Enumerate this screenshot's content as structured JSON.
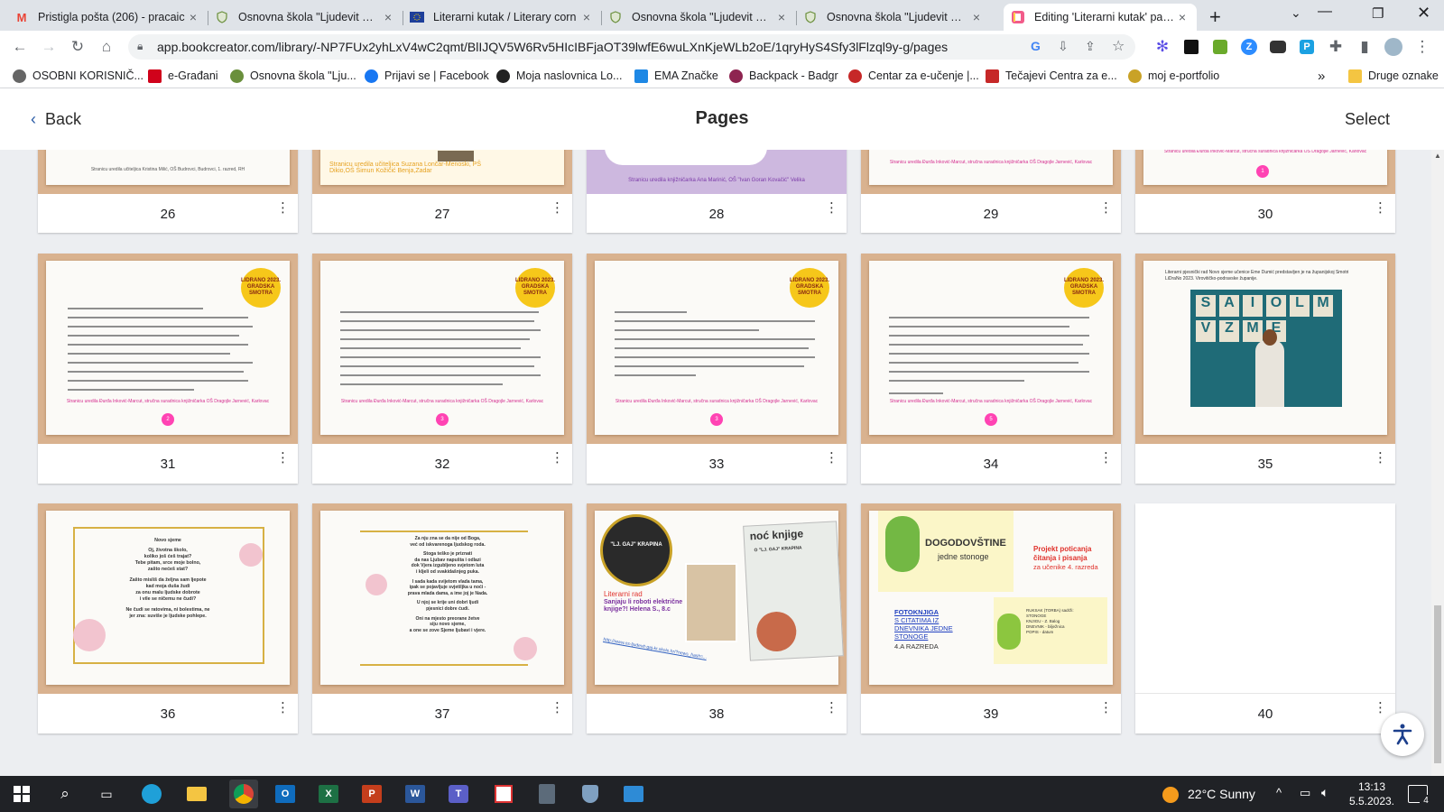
{
  "browser": {
    "tabs": [
      {
        "title": "Pristigla pošta (206) - pracaic",
        "icon": "gmail-icon"
      },
      {
        "title": "Osnovna škola \"Ljudevit Gaj\"",
        "icon": "school-shield-icon"
      },
      {
        "title": "Literarni kutak / Literary corn",
        "icon": "eu-flag-icon"
      },
      {
        "title": "Osnovna škola \"Ljudevit Gaj\"",
        "icon": "school-shield-icon"
      },
      {
        "title": "Osnovna škola \"Ljudevit Gaj\"",
        "icon": "school-shield-icon"
      },
      {
        "title": "Editing 'Literarni kutak' pages",
        "icon": "book-creator-icon"
      }
    ],
    "url": "app.bookcreator.com/library/-NP7FUx2yhLxV4wC2qmt/BlIJQV5W6Rv5HIcIBFjaOT39lwfE6wuLXnKjeWLb2oE/1qryHyS4Sfy3lFlzql9y-g/pages",
    "bookmarks": [
      {
        "label": "OSOBNI KORISNIČ...",
        "color": "#666666"
      },
      {
        "label": "e-Građani",
        "color": "#d0021b"
      },
      {
        "label": "Osnovna škola \"Lju...",
        "color": "#6a8f3c"
      },
      {
        "label": "Prijavi se | Facebook",
        "color": "#1877f2"
      },
      {
        "label": "Moja naslovnica Lo...",
        "color": "#222222"
      },
      {
        "label": "EMA Značke",
        "color": "#1e88e5"
      },
      {
        "label": "Backpack - Badgr",
        "color": "#8e2450"
      },
      {
        "label": "Centar za e-učenje |...",
        "color": "#c62828"
      },
      {
        "label": "Tečajevi Centra za e...",
        "color": "#c62828"
      },
      {
        "label": "moj e-portfolio",
        "color": "#c9a227"
      }
    ],
    "other_bookmarks": "Druge oznake",
    "more_bookmarks": "»"
  },
  "app": {
    "back_label": "Back",
    "title": "Pages",
    "select_label": "Select"
  },
  "pages": {
    "row_top": [
      "26",
      "27",
      "28",
      "29",
      "30"
    ],
    "row_mid": [
      "31",
      "32",
      "33",
      "34",
      "35"
    ],
    "row_bottom": [
      "36",
      "37",
      "38",
      "39",
      "40"
    ],
    "badge_text": "LIDRANO 2023. GRADSKA SMOTRA",
    "credit_30": "Stranicu uredila Đurđa Inković-Marcut, stručna suradnica knjižničarka OŠ Dragojle Jarnević, Karlovac",
    "credit_26": "Stranicu uredila učiteljica Kristina Milić, OŠ Budrovci, Budrovci, 1. razred, RH",
    "credit_27": "Stranicu uredila učiteljica Suzana Lončar-Menoski, PŠ Dikio,OŠ Šimun Kožičić Benja,Zadar",
    "credit_28": "Stranicu uredila knjižničarka Ana Marinić, OŠ \"Ivan Goran Kovačić\" Velika",
    "poem36": {
      "title": "Novo sjeme",
      "lines": [
        "Oj, životna školo,",
        "koliko još ćeš trajat?",
        "Tebe pitam, srce moje bolno,",
        "zašto nećeš stat?",
        "",
        "Zašto misliš da željna sam ljepote",
        "kad moja duša žudi",
        "za onu malu ljudske dobrote",
        "i vile se ničemu ne čudi?",
        "",
        "Ne čudi se ratovima, ni bolestima, ne",
        "jer zna: suviše je ljudske pohlepe."
      ]
    },
    "poem37": {
      "lines": [
        "Za nju zna se da nije od Boga,",
        "već od iskvarenoga ljudskog roda.",
        "",
        "Stoga teško je priznati",
        "da nas Ljubav napušta i odlazi",
        "dok Vjera izgubljeno svjetom luta",
        "i kljeli od svakidašnjeg puka.",
        "",
        "I sada kada svijetom vlada tama,",
        "ipak se pojavljuje svjetiljka u noći -",
        "prava mlada dama, a ime joj je Nada.",
        "",
        "U njoj se krije uni dobri ljudi",
        "pjesnici dobre ćudi.",
        "",
        "Oni na mjesto preorane žetve",
        "siju novo sjeme,",
        "a one se zove Sjeme ljubavi i vjere."
      ]
    },
    "page38": {
      "badge_line1": "\"LJ. GAJ\" KRAPINA",
      "headline": "Literarni rad",
      "subtitle": "Sanjaju li roboti električne knjige?! Helena S., 8.c",
      "link": "http://www.os-ljudevit-gaj-kr.skole.hr/?news_hash=...",
      "poster_title": "noć knjige",
      "poster_sub": "O \"LJ. GAJ\" KRAPINA"
    },
    "page39": {
      "title": "DOGODOVŠTINE",
      "subtitle": "jedne stonoge",
      "project_title": "Projekt poticanja čitanja i pisanja",
      "project_sub": "za učenike 4. razreda",
      "fotoknjiga": "FOTOKNJIGA",
      "fotoknjiga_lines": [
        "S CITATIMA IZ",
        "DNEVNIKA JEDNE",
        "STONOGE",
        "4.A RAZREDA"
      ],
      "ruksak_title": "RUKSAK (TORBA) sadrži:",
      "ruksak_items": [
        "STONOGE",
        "KNJIGU - Z. Balog",
        "DNEVNIK - bilježnica",
        "POPIS - datum"
      ]
    },
    "page35": {
      "letters": [
        "S",
        "A",
        "I",
        "O",
        "L",
        "M",
        "V",
        "Z",
        "M",
        "E"
      ],
      "caption": "Literarni pjesnički rad Novo sjeme učenice Eme Dumić predstavljen je na županijskoj Smotri LiDraNo 2023. Virovitičko-podravske županije."
    }
  },
  "taskbar": {
    "weather": "22°C  Sunny",
    "time": "13:13",
    "date": "5.5.2023.",
    "notifications": "4"
  },
  "colors": {
    "accent_pink": "#ff43b3",
    "desk_wood": "#d9b28f",
    "app_bg": "#eceef1",
    "badge_yellow": "#f6c71a"
  }
}
